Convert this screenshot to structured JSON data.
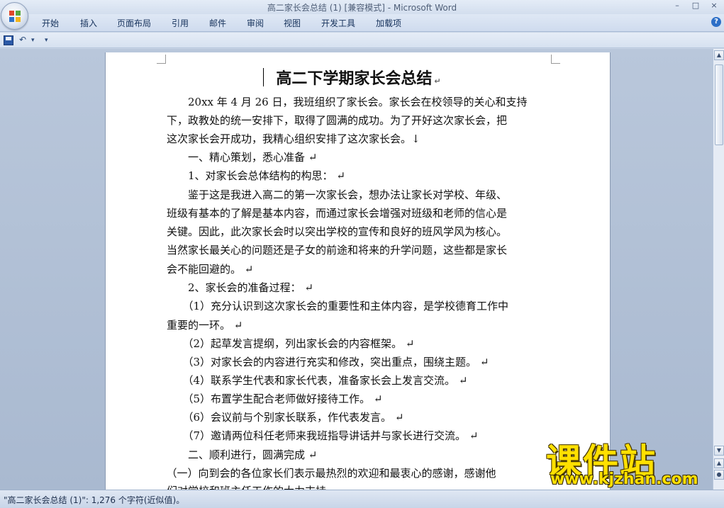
{
  "window": {
    "title": "高二家长会总结 (1) [兼容模式] - Microsoft Word",
    "controls": [
      "–",
      "□",
      "×"
    ]
  },
  "ribbon": {
    "tabs": [
      "开始",
      "插入",
      "页面布局",
      "引用",
      "邮件",
      "审阅",
      "视图",
      "开发工具",
      "加载项"
    ],
    "help": "?"
  },
  "qat": {
    "undo": "↶",
    "dropdown": "▾",
    "customize": "▾"
  },
  "document": {
    "title": "高二下学期家长会总结",
    "lines": [
      "　　20xx 年 4 月 26 日，我班组织了家长会。家长会在校领导的关心和支持",
      "下，政教处的统一安排下，取得了圆满的成功。为了开好这次家长会，把",
      "这次家长会开成功，我精心组织安排了这次家长会。↓",
      "　　一、精心策划，悉心准备 ↵",
      "　　1、对家长会总体结构的构思： ↵",
      "　　鉴于这是我进入高二的第一次家长会，想办法让家长对学校、年级、",
      "班级有基本的了解是基本内容，而通过家长会增强对班级和老师的信心是",
      "关键。因此，此次家长会时以突出学校的宣传和良好的班风学风为核心。",
      "当然家长最关心的问题还是子女的前途和将来的升学问题，这些都是家长",
      "会不能回避的。 ↵",
      "　　2、家长会的准备过程： ↵",
      "　　（1）充分认识到这次家长会的重要性和主体内容，是学校德育工作中",
      "重要的一环。 ↵",
      "　　（2）起草发言提纲，列出家长会的内容框架。 ↵",
      "　　（3）对家长会的内容进行充实和修改，突出重点，围绕主题。 ↵",
      "　　（4）联系学生代表和家长代表，准备家长会上发言交流。 ↵",
      "　　（5）布置学生配合老师做好接待工作。 ↵",
      "　　（6）会议前与个别家长联系，作代表发言。 ↵",
      "　　（7）邀请两位科任老师来我班指导讲话并与家长进行交流。 ↵",
      "　　二、顺利进行，圆满完成 ↵",
      "　（一）向到会的各位家长们表示最热烈的欢迎和最衷心的感谢，感谢他",
      "们对学校和班主任工作的大力支持"
    ]
  },
  "statusbar": {
    "text": "\"高二家长会总结 (1)\": 1,276 个字符(近似值)。"
  },
  "watermark": {
    "brand": "课件站",
    "url": "www.kjzhan.com"
  },
  "colors": {
    "office_red": "#e0472b",
    "office_green": "#57a640",
    "office_blue": "#2e72c9",
    "office_yellow": "#f2b51c"
  }
}
